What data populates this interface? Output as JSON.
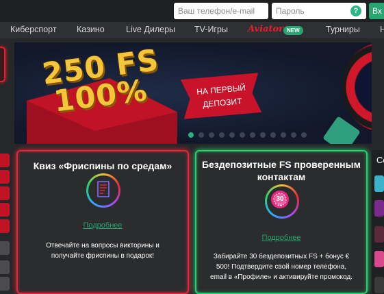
{
  "login": {
    "phone_placeholder": "Ваш телефон/e-mail",
    "password_placeholder": "Пароль",
    "help_label": "?",
    "login_button": "Вх"
  },
  "nav": {
    "items": [
      "Киберспорт",
      "Казино",
      "Live Дилеры",
      "TV-Игры",
      "Турниры",
      "Н"
    ],
    "aviator_label": "Aviator",
    "new_badge": "NEW"
  },
  "banner": {
    "headline_line1": "250 FS",
    "headline_line2": "100%",
    "ribbon_text": "НА ПЕРВЫЙ ДЕПОЗИТ",
    "slide_count": 12,
    "active_slide": 1
  },
  "cards": [
    {
      "title": "Квиз «Фриспины по средам»",
      "link": "Подробнее",
      "description": "Отвечайте на вопросы викторины и получайте фриспины в подарок!",
      "icon": "quiz-document-icon"
    },
    {
      "title": "Бездепозитные FS проверенным контактам",
      "link": "Подробнее",
      "description": "Забирайте 30 бездепозитных FS + бонус € 500! Подтвердите свой номер телефона, email в «Профиле» и активируйте промокод.",
      "icon": "30-fs-chip-icon",
      "icon_text": "30",
      "icon_subtext": "FS"
    }
  ],
  "right_panel": {
    "title_partial": "Се"
  },
  "colors": {
    "accent_green": "#27a672",
    "accent_red": "#e62638",
    "background": "#262729"
  }
}
